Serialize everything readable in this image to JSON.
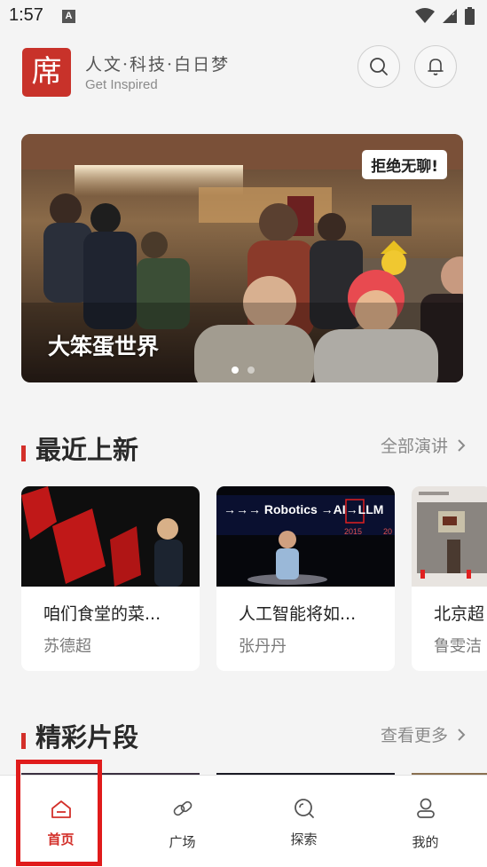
{
  "status_bar": {
    "time": "1:57",
    "notification_icon": "A"
  },
  "header": {
    "logo_char": "席",
    "slogan": "人文·科技·白日梦",
    "subslogan": "Get Inspired",
    "search_icon": "search-icon",
    "bell_icon": "bell-icon"
  },
  "banner": {
    "tag": "拒绝无聊!",
    "title": "大笨蛋世界",
    "active_slide": 1,
    "slide_count": 2
  },
  "recent": {
    "title": "最近上新",
    "more": "全部演讲",
    "cards": [
      {
        "title": "咱们食堂的菜...",
        "author": "苏德超"
      },
      {
        "title": "人工智能将如...",
        "author": "张丹丹",
        "thumb_text": "→→→ Robotics →AI→LLM",
        "thumb_years": [
          "2015",
          "20"
        ]
      },
      {
        "title": "北京超",
        "author": "鲁雯洁"
      }
    ]
  },
  "clips": {
    "title": "精彩片段",
    "more": "查看更多"
  },
  "bottom_nav": {
    "items": [
      {
        "label": "首页",
        "icon": "home-icon",
        "active": true
      },
      {
        "label": "广场",
        "icon": "link-icon",
        "active": false
      },
      {
        "label": "探索",
        "icon": "explore-icon",
        "active": false
      },
      {
        "label": "我的",
        "icon": "user-icon",
        "active": false
      }
    ]
  },
  "colors": {
    "accent": "#d3302a",
    "highlight_box": "#e01b1b"
  }
}
